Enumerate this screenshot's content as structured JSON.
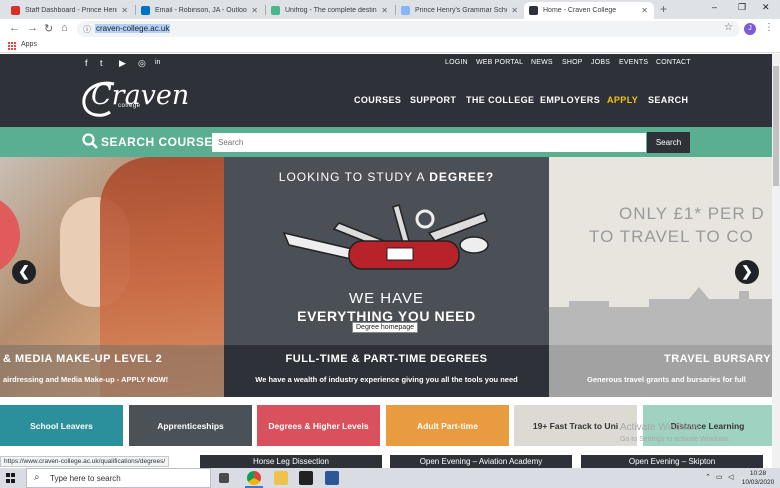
{
  "browser": {
    "tabs": [
      {
        "title": "Staff Dashboard - Prince Henry's",
        "favicon_color": "#d93025",
        "active": false
      },
      {
        "title": "Email - Robinson, JA - Outlook",
        "favicon_color": "#0072c6",
        "active": false
      },
      {
        "title": "Unifrog - The complete destinati",
        "favicon_color": "#4bb58c",
        "active": false
      },
      {
        "title": "Prince Henry's Grammar School",
        "favicon_color": "#8ab4f8",
        "active": false
      },
      {
        "title": "Home - Craven College",
        "favicon_color": "#2e3238",
        "active": true
      }
    ],
    "new_tab": "+",
    "window_controls": [
      "–",
      "❐",
      "✕"
    ],
    "url": "craven-college.ac.uk",
    "profile_initial": "J",
    "bookmarks": {
      "apps_label": "Apps"
    }
  },
  "site": {
    "social_icons": [
      "f",
      "t",
      "▶",
      "◎",
      "in"
    ],
    "util_links": [
      "LOGIN",
      "WEB PORTAL",
      "NEWS",
      "SHOP",
      "JOBS",
      "EVENTS",
      "CONTACT"
    ],
    "logo": {
      "name": "Craven",
      "sub": "college"
    },
    "nav": [
      "COURSES",
      "SUPPORT",
      "THE COLLEGE",
      "EMPLOYERS",
      "APPLY",
      "SEARCH"
    ],
    "search": {
      "title": "SEARCH COURSES",
      "placeholder": "Search",
      "button": "Search"
    },
    "slides": {
      "left": {
        "title": "& MEDIA MAKE-UP LEVEL 2",
        "subtitle": "airdressing and Media Make-up - APPLY NOW!"
      },
      "middle": {
        "question_prefix": "LOOKING TO STUDY A",
        "question_bold": "DEGREE?",
        "line1": "WE HAVE",
        "line2": "EVERYTHING YOU NEED",
        "tooltip": "Degree homepage",
        "title": "FULL-TIME & PART-TIME DEGREES",
        "subtitle": "We have a wealth of industry experience giving you all the tools you need"
      },
      "right": {
        "line1": "ONLY £1* PER D",
        "line2": "TO TRAVEL TO CO",
        "title": "TRAVEL BURSARY",
        "subtitle": "Generous travel grants and bursaries for full"
      }
    },
    "arrows": {
      "prev": "❮",
      "next": "❯"
    },
    "quick_links": [
      {
        "label": "School Leavers",
        "color": "#2b8f9c"
      },
      {
        "label": "Apprenticeships",
        "color": "#4b5257"
      },
      {
        "label": "Degrees & Higher Levels",
        "color": "#d9515c"
      },
      {
        "label": "Adult Part-time",
        "color": "#e89b3f"
      },
      {
        "label": "19+ Fast Track to Uni",
        "color": "#ddd9d3"
      },
      {
        "label": "Distance Learning",
        "color": "#9fd2c1"
      }
    ],
    "events": [
      "Horse Leg Dissection",
      "Open Evening – Aviation Academy",
      "Open Evening – Skipton"
    ],
    "status_url": "https://www.craven-college.ac.uk/qualifications/degrees/",
    "watermark": {
      "line1": "Activate Windows",
      "line2": "Go to Settings to activate Windows."
    }
  },
  "taskbar": {
    "search_placeholder": "Type here to search",
    "time": "10:28",
    "date": "10/03/2020"
  }
}
